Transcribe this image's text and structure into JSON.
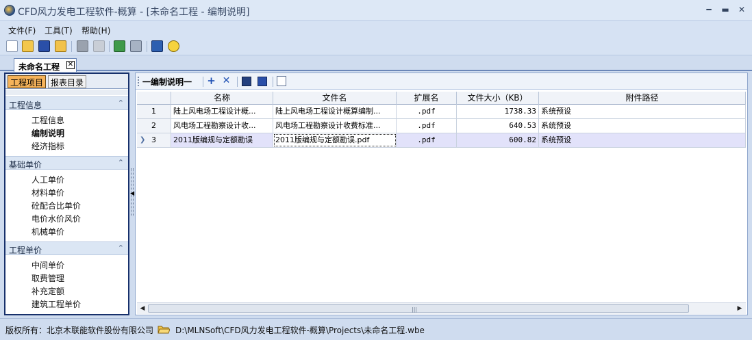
{
  "window": {
    "title": "CFD风力发电工程软件-概算 - [未命名工程 - 编制说明]",
    "minimize": "━",
    "maximize": "▬",
    "close": "✕"
  },
  "menu": {
    "items": [
      {
        "label": "文件(F)"
      },
      {
        "label": "工具(T)"
      },
      {
        "label": "帮助(H)"
      }
    ]
  },
  "toolbar": {
    "icons": [
      "new-file-icon",
      "open-folder-icon",
      "save-icon",
      "export-folder-icon",
      "book-icon",
      "book-disabled-icon",
      "excel-refresh-icon",
      "calculator-icon",
      "help-book-icon",
      "info-icon"
    ]
  },
  "document_tab": {
    "label": "未命名工程",
    "close": "✕"
  },
  "left_panel": {
    "tabs": [
      {
        "label": "工程项目",
        "active": true
      },
      {
        "label": "报表目录",
        "active": false
      }
    ],
    "sections": [
      {
        "title": "工程信息",
        "items": [
          "工程信息",
          "编制说明",
          "经济指标"
        ]
      },
      {
        "title": "基础单价",
        "items": [
          "人工单价",
          "材料单价",
          "砼配合比单价",
          "电价水价风价",
          "机械单价"
        ]
      },
      {
        "title": "工程单价",
        "items": [
          "中间单价",
          "取费管理",
          "补充定额",
          "建筑工程单价"
        ]
      }
    ],
    "selected_item": "编制说明",
    "chevron": "⌃"
  },
  "content": {
    "toolbar_title": "一编制说明一",
    "add_icon": "+",
    "delete_icon": "✕"
  },
  "grid": {
    "columns": [
      "名称",
      "文件名",
      "扩展名",
      "文件大小（KB）",
      "附件路径"
    ],
    "rows": [
      {
        "index": "1",
        "name": "陆上风电场工程设计概...",
        "filename": "陆上风电场工程设计概算编制...",
        "ext": ".pdf",
        "size": "1738.33",
        "path": "系统预设"
      },
      {
        "index": "2",
        "name": "风电场工程勘察设计收...",
        "filename": "风电场工程勘察设计收费标准...",
        "ext": ".pdf",
        "size": "640.53",
        "path": "系统预设"
      },
      {
        "index": "3",
        "name": "2011版编规与定额勘误",
        "filename": "2011版编规与定额勘误.pdf",
        "ext": ".pdf",
        "size": "600.82",
        "path": "系统预设"
      }
    ],
    "current_row_marker": "❯"
  },
  "statusbar": {
    "copyright": "版权所有：北京木联能软件股份有限公司",
    "path": "D:\\MLNSoft\\CFD风力发电工程软件-概算\\Projects\\未命名工程.wbe"
  }
}
